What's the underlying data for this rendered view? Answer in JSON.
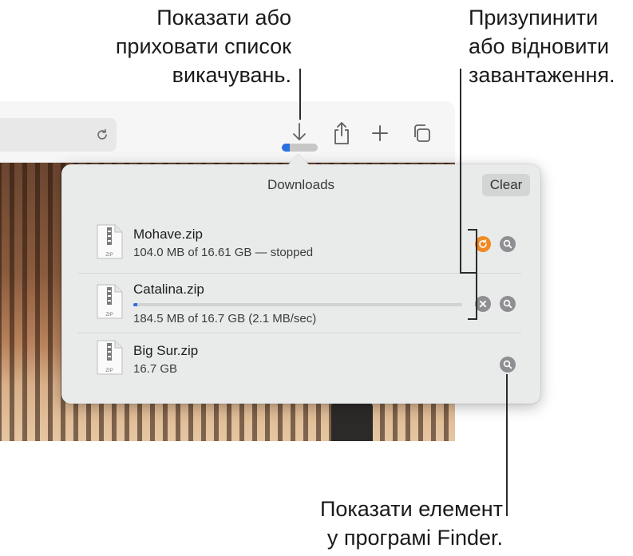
{
  "callouts": {
    "toggle_list": "Показати або\nприховати список\nвикачувань.",
    "pause_resume": "Призупинити\nабо відновити\nзавантаження.",
    "show_in_finder": "Показати елемент\nу програмі Finder."
  },
  "toolbar": {
    "download_progress": 0.22,
    "icons": [
      "reload-icon",
      "download-icon",
      "share-icon",
      "plus-icon",
      "tabs-overview-icon"
    ]
  },
  "downloads": {
    "title": "Downloads",
    "clear_label": "Clear",
    "items": [
      {
        "name": "Mohave.zip",
        "status": "104.0 MB of 16.61 GB — stopped",
        "state": "stopped",
        "actions": [
          "resume-icon",
          "magnifier-icon"
        ]
      },
      {
        "name": "Catalina.zip",
        "status": "184.5 MB of 16.7 GB (2.1 MB/sec)",
        "state": "downloading",
        "progress": 0.011,
        "actions": [
          "stop-icon",
          "magnifier-icon"
        ]
      },
      {
        "name": "Big Sur.zip",
        "status": "16.7 GB",
        "state": "complete",
        "actions": [
          "magnifier-icon"
        ]
      }
    ]
  },
  "colors": {
    "resume_accent": "#f08a24",
    "progress_blue": "#2b6fe0",
    "action_gray": "#8e8e93"
  }
}
